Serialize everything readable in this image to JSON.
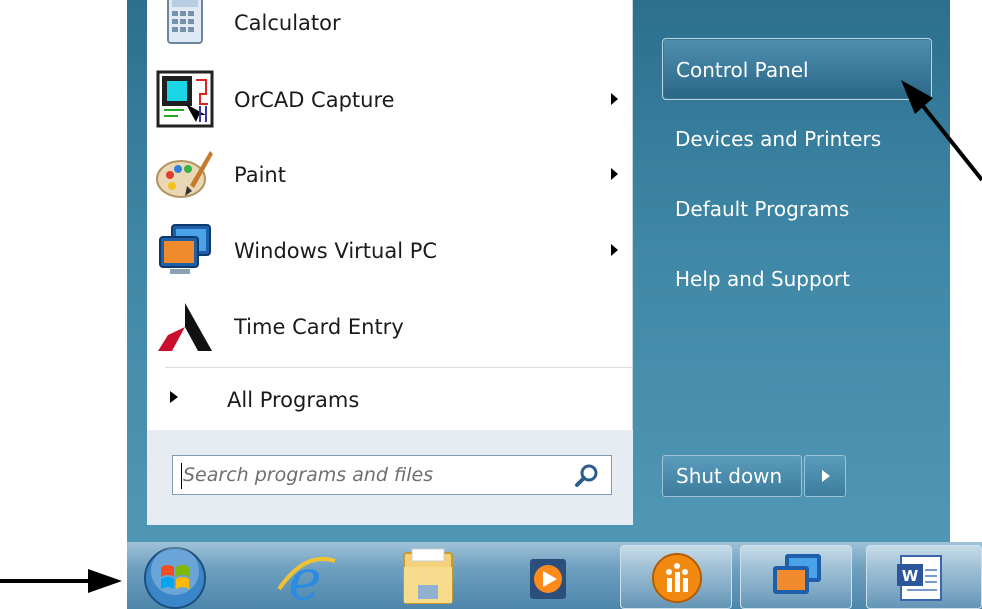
{
  "programs": [
    {
      "label": "Calculator",
      "icon": "calculator-icon",
      "submenu": false
    },
    {
      "label": "OrCAD Capture",
      "icon": "orcad-capture-icon",
      "submenu": true
    },
    {
      "label": "Paint",
      "icon": "paint-palette-icon",
      "submenu": true
    },
    {
      "label": "Windows Virtual PC",
      "icon": "virtual-pc-icon",
      "submenu": true
    },
    {
      "label": "Time Card Entry",
      "icon": "time-card-icon",
      "submenu": false
    }
  ],
  "all_programs": {
    "label": "All Programs"
  },
  "search": {
    "placeholder": "Search programs and files"
  },
  "right_links": [
    {
      "label": "Control Panel",
      "selected": true
    },
    {
      "label": "Devices and Printers",
      "selected": false
    },
    {
      "label": "Default Programs",
      "selected": false
    },
    {
      "label": "Help and Support",
      "selected": false
    }
  ],
  "shutdown": {
    "label": "Shut down"
  },
  "taskbar": [
    {
      "name": "start-orb",
      "icon": "windows-logo-icon"
    },
    {
      "name": "internet-explorer",
      "icon": "internet-explorer-icon"
    },
    {
      "name": "file-explorer",
      "icon": "folder-icon"
    },
    {
      "name": "media-player",
      "icon": "media-player-icon"
    },
    {
      "name": "app-orange",
      "icon": "orange-circle-icon",
      "active": true
    },
    {
      "name": "virtual-pc",
      "icon": "virtual-pc-icon",
      "active": true
    },
    {
      "name": "word",
      "icon": "word-icon"
    }
  ],
  "colors": {
    "menu_blue": "#3f87a6",
    "taskbar": "#6d9fbf",
    "annotation": "#000000"
  }
}
